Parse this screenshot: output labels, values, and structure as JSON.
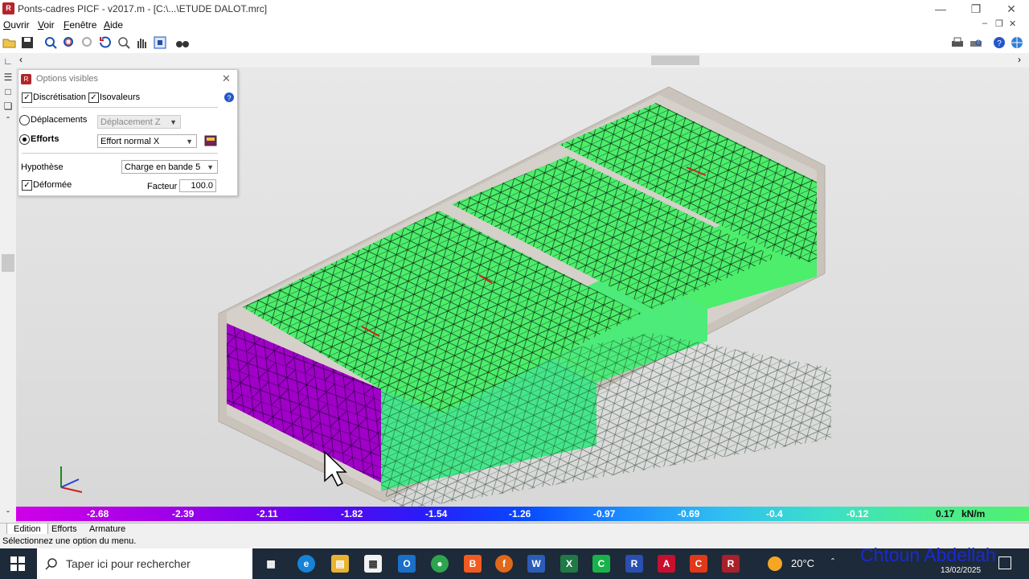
{
  "window": {
    "title": "Ponts-cadres PICF - v2017.m - [C:\\...\\ETUDE DALOT.mrc]"
  },
  "menu": [
    "Ouvrir",
    "Voir",
    "Fenêtre",
    "Aide"
  ],
  "options_panel": {
    "title": "Options visibles",
    "discretisation_label": "Discrétisation",
    "isovaleurs_label": "Isovaleurs",
    "deplacements_label": "Déplacements",
    "deplacements_select": "Déplacement Z",
    "efforts_label": "Efforts",
    "efforts_select": "Effort normal X",
    "hypothese_label": "Hypothèse",
    "hypothese_select": "Charge en bande 5",
    "deformee_label": "Déformée",
    "facteur_label": "Facteur",
    "facteur_value": "100.0"
  },
  "scale": {
    "values": [
      "-2.68",
      "-2.39",
      "-2.11",
      "-1.82",
      "-1.54",
      "-1.26",
      "-0.97",
      "-0.69",
      "-0.4",
      "-0.12",
      "0.17"
    ],
    "unit": "kN/m"
  },
  "tabs": [
    "Edition",
    "Efforts",
    "Armature"
  ],
  "status": "Sélectionnez une option du menu.",
  "taskbar": {
    "search_placeholder": "Taper ici pour rechercher",
    "temperature": "20°C",
    "date": "13/02/2025"
  },
  "watermark": "Chtoun Abdellah",
  "colors": {
    "mesh_green": "#4cee6c",
    "mesh_purple": "#a000c8",
    "concrete": "#c9c3bc",
    "taskbar": "#1d2a3a"
  }
}
